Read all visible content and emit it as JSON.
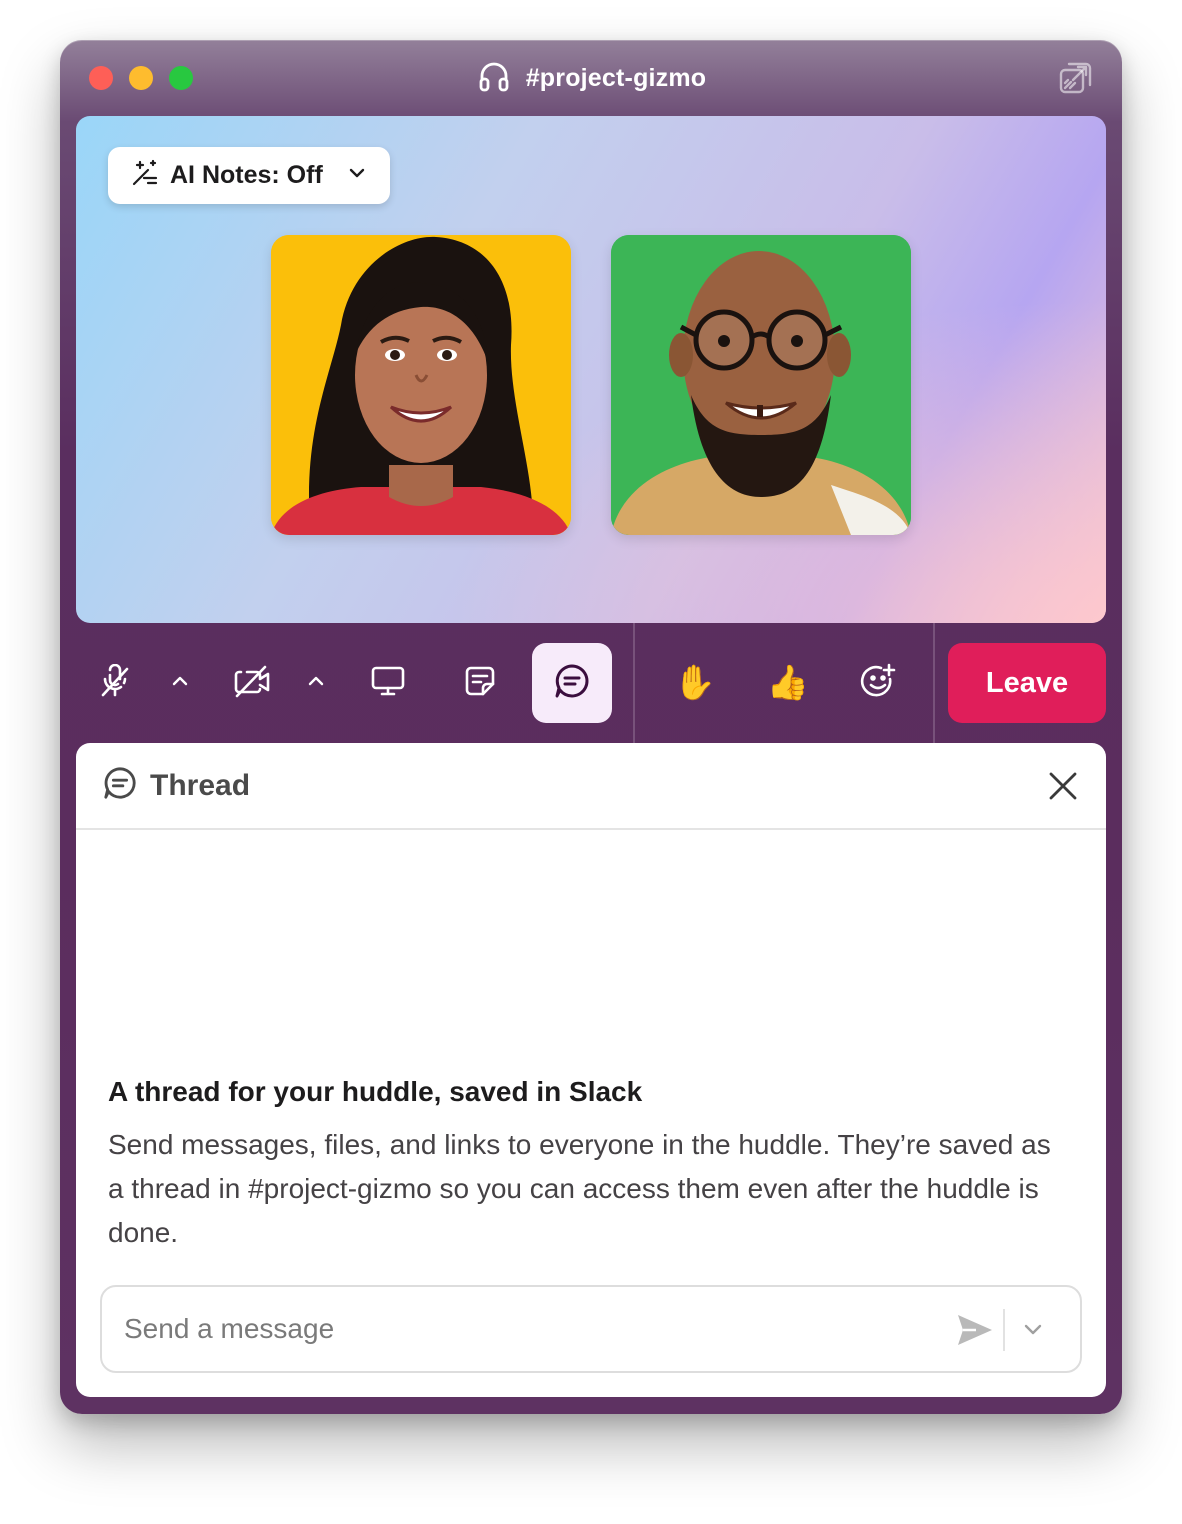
{
  "window": {
    "title": "#project-gizmo"
  },
  "huddle": {
    "ai_notes_label": "AI Notes: Off",
    "participants": [
      {
        "avatar_color": "#fbbf0a"
      },
      {
        "avatar_color": "#3cb556"
      }
    ]
  },
  "controls": {
    "raise_hand_emoji": "✋",
    "thumbs_up_emoji": "👍",
    "leave_label": "Leave",
    "leave_color": "#e01e5a",
    "active_bg": "#f7ebfa"
  },
  "thread_panel": {
    "title": "Thread",
    "intro_title": "A thread for your huddle, saved in Slack",
    "intro_body": "Send messages, files, and links to everyone in the huddle. They’re saved as a thread in #project-gizmo so you can access them even after the huddle is done.",
    "composer": {
      "placeholder": "Send a message",
      "value": ""
    }
  },
  "icons": {
    "titlebar": [
      "headphones-icon",
      "popout-icon"
    ],
    "controls": [
      "mic-off-icon",
      "chevron-up-icon",
      "camera-off-icon",
      "chevron-up-icon",
      "screen-share-icon",
      "canvas-note-icon",
      "thread-icon",
      "raise-hand-emoji",
      "thumbs-up-emoji",
      "add-reaction-icon"
    ],
    "panel": [
      "thread-icon",
      "close-icon",
      "send-icon",
      "chevron-down-icon"
    ]
  }
}
